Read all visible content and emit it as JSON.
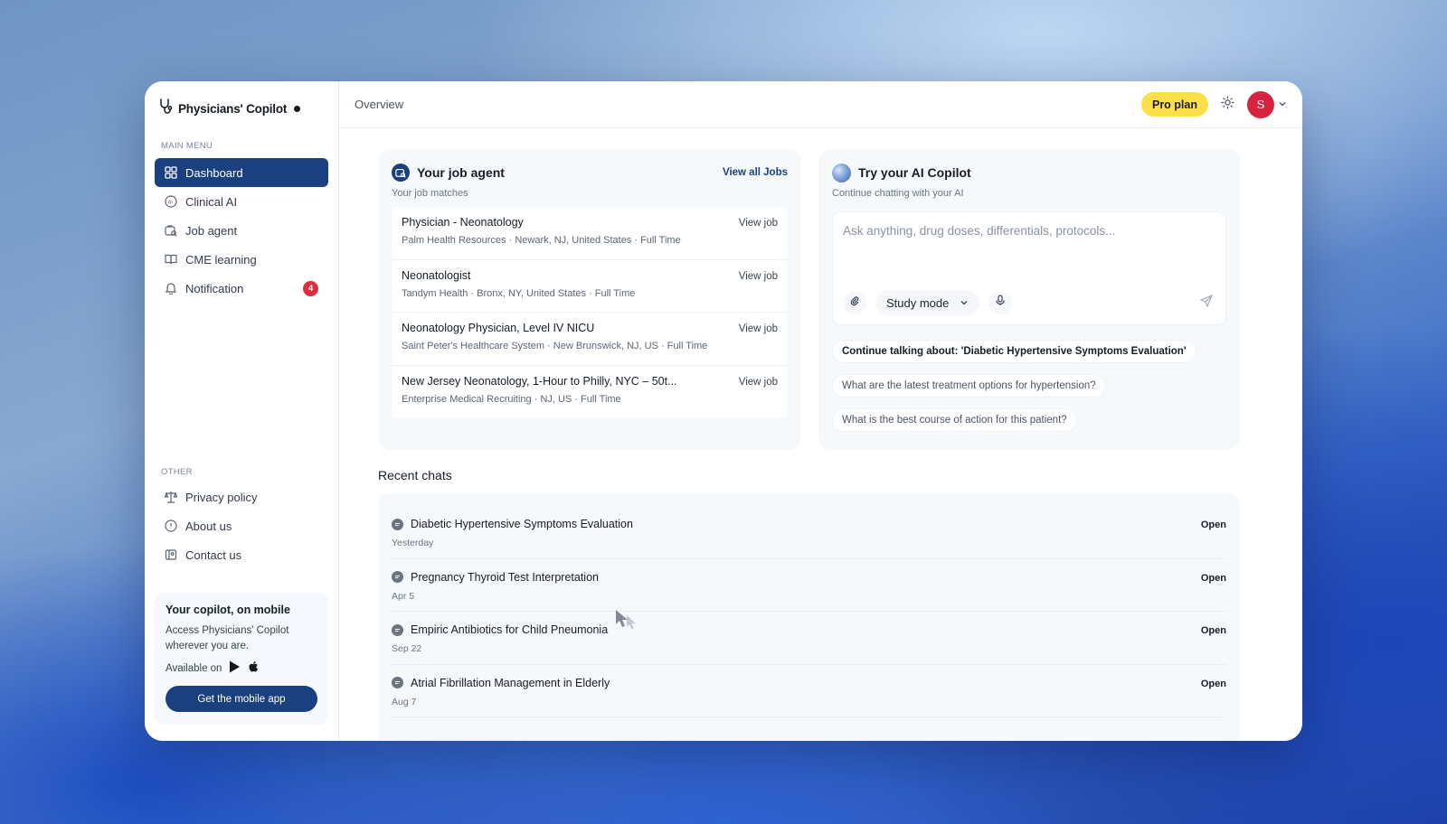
{
  "brand": {
    "name": "Physicians' Copilot"
  },
  "sidebar": {
    "main_label": "MAIN MENU",
    "items": [
      {
        "label": "Dashboard",
        "icon": "grid-icon",
        "active": true
      },
      {
        "label": "Clinical AI",
        "icon": "ai-chip-icon"
      },
      {
        "label": "Job agent",
        "icon": "job-search-icon"
      },
      {
        "label": "CME learning",
        "icon": "book-icon"
      },
      {
        "label": "Notification",
        "icon": "bell-icon",
        "badge": "4"
      }
    ],
    "other_label": "OTHER",
    "other_items": [
      {
        "label": "Privacy policy",
        "icon": "scale-icon"
      },
      {
        "label": "About us",
        "icon": "info-icon"
      },
      {
        "label": "Contact us",
        "icon": "contact-book-icon"
      }
    ],
    "mobile": {
      "title": "Your copilot, on mobile",
      "description": "Access Physicians' Copilot wherever you are.",
      "available": "Available on",
      "button": "Get the mobile app"
    }
  },
  "topbar": {
    "breadcrumb": "Overview",
    "plan": "Pro plan",
    "avatar_initial": "S"
  },
  "job_agent": {
    "title": "Your job agent",
    "view_all": "View all Jobs",
    "subtitle": "Your job matches",
    "jobs": [
      {
        "title": "Physician - Neonatology",
        "meta": "Palm Health Resources · Newark, NJ, United States · Full Time",
        "link": "View job"
      },
      {
        "title": "Neonatologist",
        "meta": "Tandym Health · Bronx, NY, United States · Full Time",
        "link": "View job"
      },
      {
        "title": "Neonatology Physician, Level IV NICU",
        "meta": "Saint Peter's Healthcare System · New Brunswick, NJ, US · Full Time",
        "link": "View job"
      },
      {
        "title": "New Jersey Neonatology, 1-Hour to Philly, NYC – 50t...",
        "meta": "Enterprise Medical Recruiting · NJ, US · Full Time",
        "link": "View job"
      }
    ]
  },
  "copilot": {
    "title": "Try your AI Copilot",
    "subtitle": "Continue chatting with your AI",
    "placeholder": "Ask anything, drug doses, differentials, protocols...",
    "mode": "Study mode",
    "suggestions": [
      "Continue talking about: 'Diabetic Hypertensive Symptoms Evaluation'",
      "What are the latest treatment options for hypertension?",
      "What is the best course of action for this patient?"
    ]
  },
  "recent": {
    "title": "Recent chats",
    "chats": [
      {
        "title": "Diabetic Hypertensive Symptoms Evaluation",
        "date": "Yesterday",
        "action": "Open"
      },
      {
        "title": "Pregnancy Thyroid Test Interpretation",
        "date": "Apr 5",
        "action": "Open"
      },
      {
        "title": "Empiric Antibiotics for Child Pneumonia",
        "date": "Sep 22",
        "action": "Open"
      },
      {
        "title": "Atrial Fibrillation Management in Elderly",
        "date": "Aug 7",
        "action": "Open"
      }
    ]
  },
  "colors": {
    "primary": "#1a4080",
    "plan": "#fbe04a",
    "badge": "#e22b3b",
    "avatar": "#d8233f"
  }
}
